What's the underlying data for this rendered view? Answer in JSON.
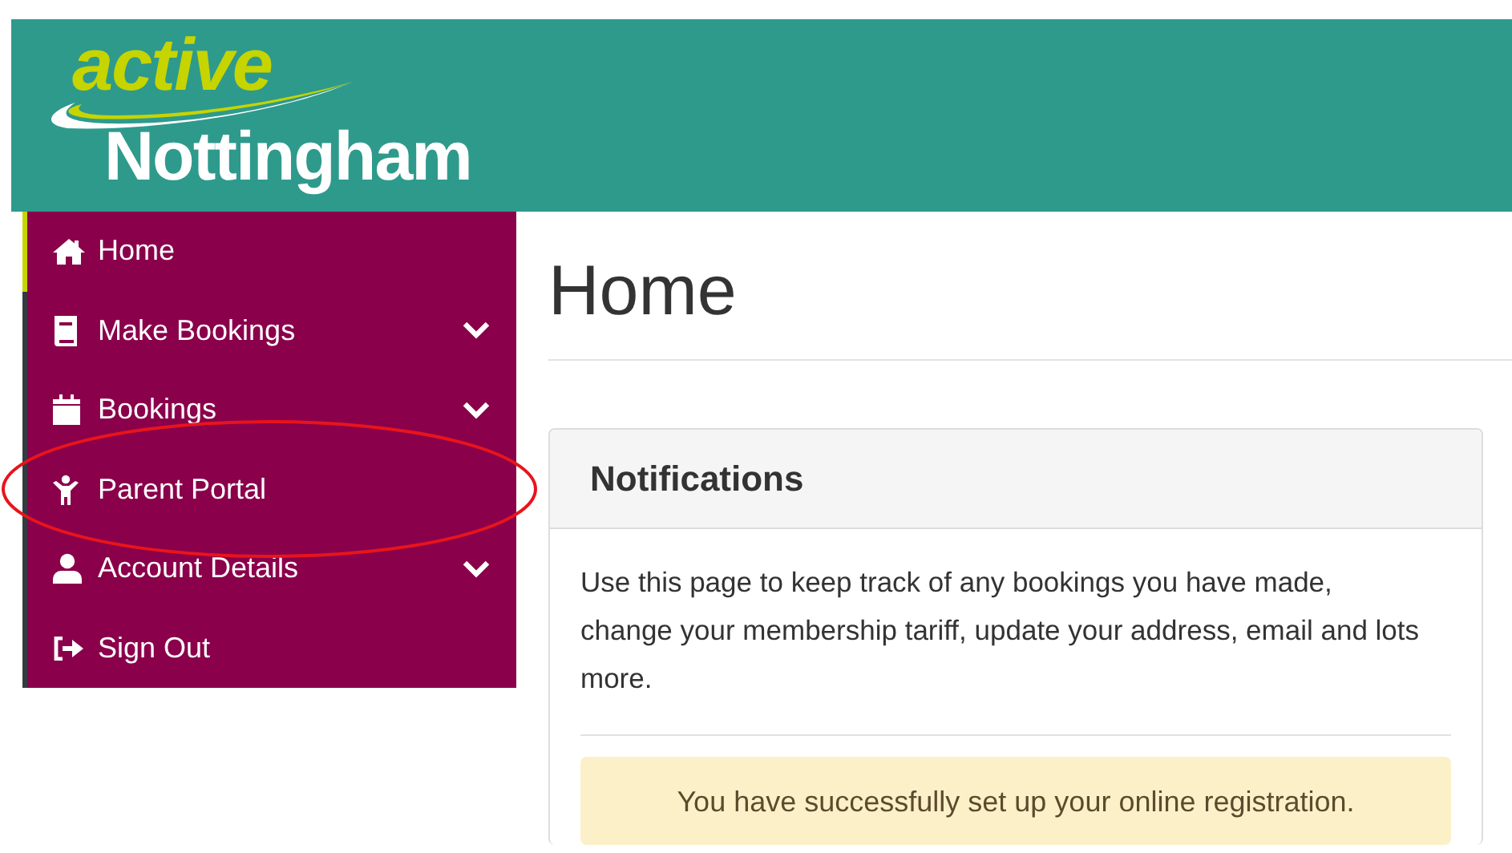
{
  "header": {
    "logo_top": "active",
    "logo_bottom": "Nottingham"
  },
  "sidebar": {
    "items": [
      {
        "kind": "home",
        "label": "Home",
        "selected": true,
        "expandable": false
      },
      {
        "kind": "book",
        "label": "Make Bookings",
        "selected": false,
        "expandable": true
      },
      {
        "kind": "calendar",
        "label": "Bookings",
        "selected": false,
        "expandable": true
      },
      {
        "kind": "child",
        "label": "Parent Portal",
        "selected": false,
        "expandable": false
      },
      {
        "kind": "user",
        "label": "Account Details",
        "selected": false,
        "expandable": true
      },
      {
        "kind": "signout",
        "label": "Sign Out",
        "selected": false,
        "expandable": false
      }
    ]
  },
  "page_title": "Home",
  "panel": {
    "title": "Notifications",
    "body": "Use this page to keep track of any bookings you have made, change your membership tariff, update your address, email and lots more.",
    "alert": "You have successfully set up your online registration."
  },
  "annotations": [
    {
      "kind": "ellipse"
    }
  ]
}
